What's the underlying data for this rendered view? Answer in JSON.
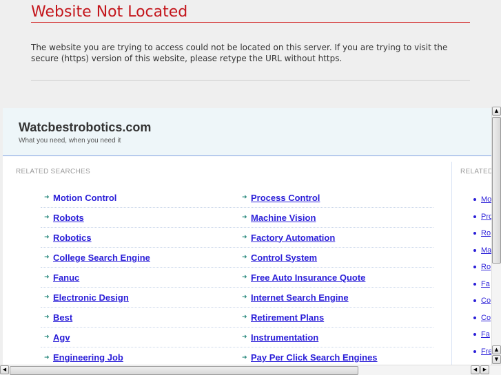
{
  "error": {
    "title": "Website Not Located",
    "message": "The website you are trying to access could not be located on this server. If you are trying to visit the secure (https) version of this website, please retype the URL without https."
  },
  "site": {
    "name": "Watcbestrobotics.com",
    "tagline": "What you need, when you need it"
  },
  "related_label": "RELATED SEARCHES",
  "related_label_right": "RELATED",
  "rows": [
    [
      "Motion Control",
      "Process Control"
    ],
    [
      "Robots",
      "Machine Vision"
    ],
    [
      "Robotics",
      "Factory Automation"
    ],
    [
      "College Search Engine",
      "Control System"
    ],
    [
      "Fanuc",
      "Free Auto Insurance Quote"
    ],
    [
      "Electronic Design",
      "Internet Search Engine"
    ],
    [
      "Best",
      "Retirement Plans"
    ],
    [
      "Agv",
      "Instrumentation"
    ],
    [
      "Engineering Job",
      "Pay Per Click Search Engines"
    ]
  ],
  "right_links": [
    "Mo",
    "Pro",
    "Ro",
    "Ma",
    "Ro",
    "Fa",
    "Co",
    "Co",
    "Fa",
    "Fre"
  ],
  "colors": {
    "error_red": "#c4161c",
    "link": "#2a1ed8",
    "arrow": "#2b8a7e"
  }
}
